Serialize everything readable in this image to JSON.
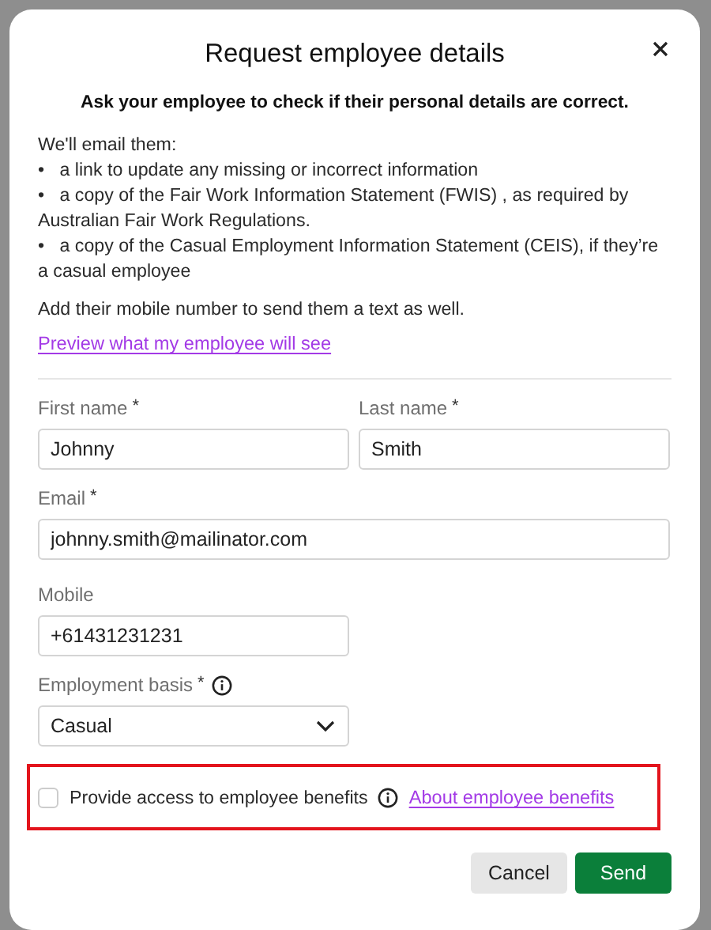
{
  "dialog": {
    "title": "Request employee details",
    "intro": "Ask your employee to check if their personal details are correct.",
    "email_lead": "We'll email them:",
    "bullets": [
      "•   a link to update any missing or incorrect information",
      "•   a copy of the Fair Work Information Statement (FWIS) , as required by Australian Fair Work Regulations.",
      "•   a copy of the Casual Employment Information Statement (CEIS), if they’re a casual employee"
    ],
    "sms_note": "Add their mobile number to send them a text as well.",
    "preview_link": "Preview what my employee will see"
  },
  "form": {
    "fields": [
      {
        "label": "First name",
        "required": true,
        "value": "Johnny",
        "kind": "text"
      },
      {
        "label": "Last name",
        "required": true,
        "value": "Smith",
        "kind": "text"
      },
      {
        "label": "Email",
        "required": true,
        "value": "johnny.smith@mailinator.com",
        "kind": "email"
      },
      {
        "label": "Mobile",
        "required": false,
        "value": "+61431231231",
        "kind": "phone"
      },
      {
        "label": "Employment basis",
        "required": true,
        "info": true,
        "value": "Casual",
        "kind": "select"
      }
    ],
    "required_mark": "*",
    "benefits": {
      "label": "Provide access to employee benefits",
      "checked": false,
      "highlighted": true,
      "link": "About employee benefits"
    }
  },
  "buttons": [
    {
      "label": "Cancel",
      "kind": "secondary"
    },
    {
      "label": "Send",
      "kind": "primary"
    }
  ]
}
